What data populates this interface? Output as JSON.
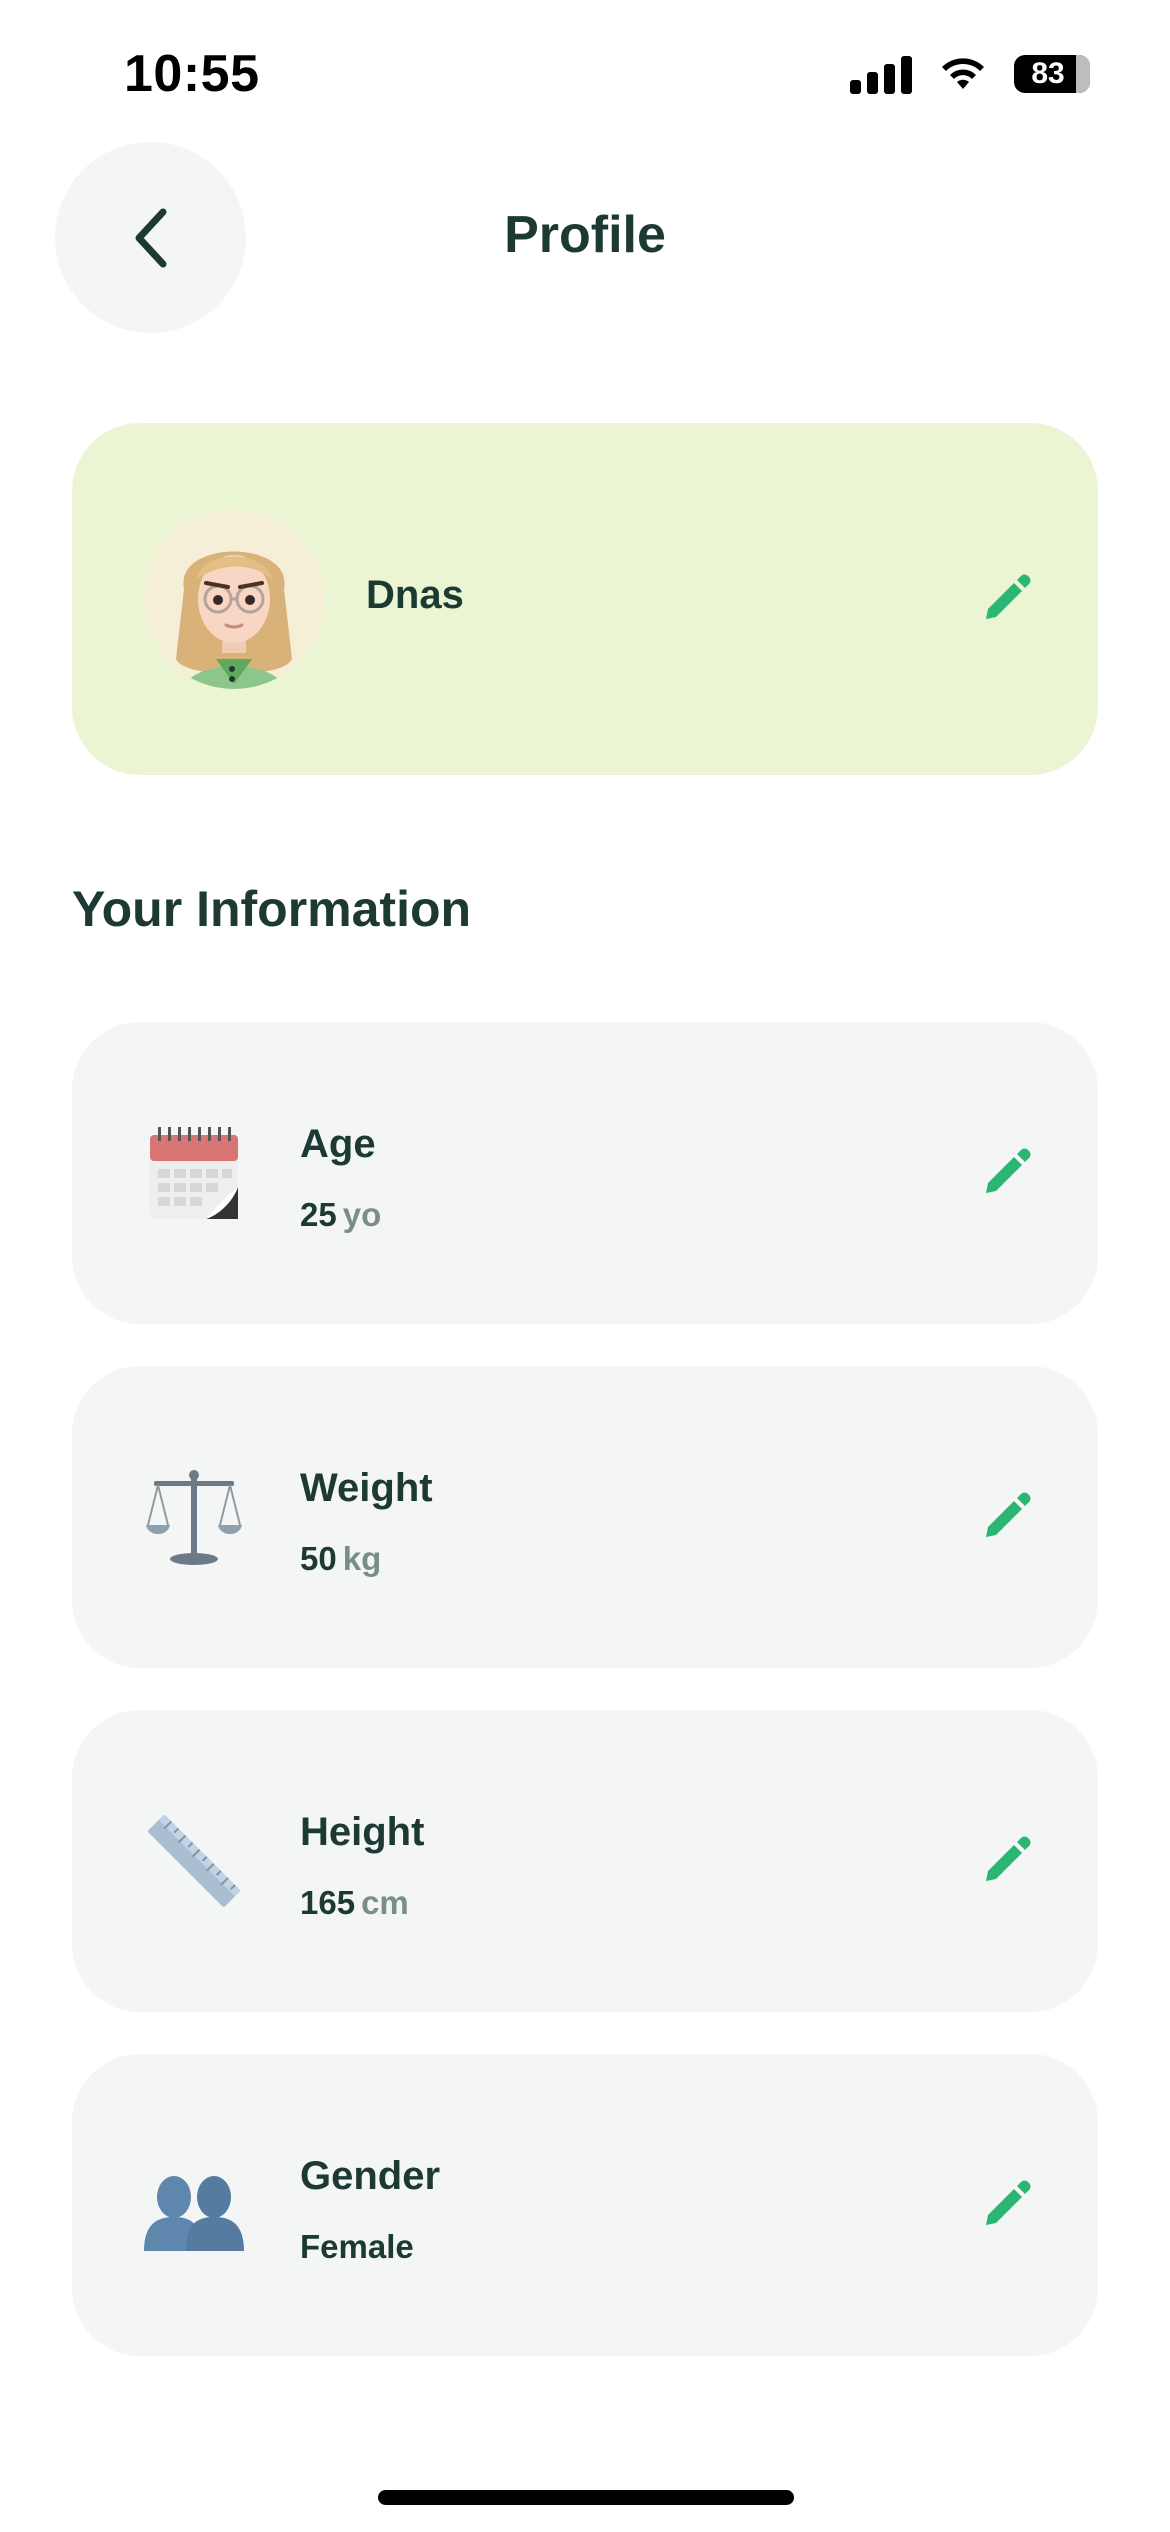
{
  "status_bar": {
    "time": "10:55",
    "battery": "83"
  },
  "header": {
    "title": "Profile",
    "back_icon": "chevron-left-icon"
  },
  "profile": {
    "name": "Dnas",
    "avatar_icon": "avatar-memoji",
    "edit_icon": "pencil-icon"
  },
  "info_section": {
    "title": "Your Information",
    "items": [
      {
        "label": "Age",
        "value": "25",
        "unit": "yo",
        "icon": "calendar-icon"
      },
      {
        "label": "Weight",
        "value": "50",
        "unit": "kg",
        "icon": "scales-icon"
      },
      {
        "label": "Height",
        "value": "165",
        "unit": "cm",
        "icon": "ruler-icon"
      },
      {
        "label": "Gender",
        "value": "Female",
        "unit": "",
        "icon": "people-icon"
      }
    ]
  },
  "colors": {
    "accent_green": "#2bb673",
    "profile_card_bg": "#ecf5d3",
    "card_bg": "#f4f6f5",
    "text_dark": "#1c3a33",
    "unit_gray": "#7a8e88"
  }
}
